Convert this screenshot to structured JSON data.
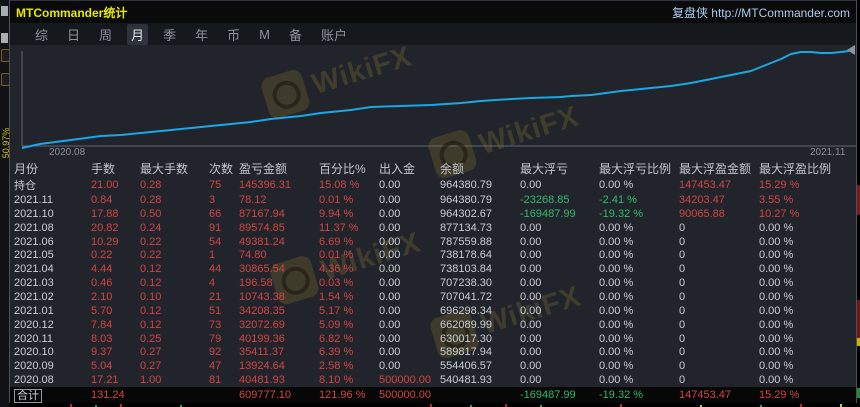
{
  "window": {
    "title": "MTCommander统计",
    "title_right": "复盘侠 http://MTCommander.com"
  },
  "menu": {
    "items": [
      {
        "label": "综",
        "active": false
      },
      {
        "label": "日",
        "active": false
      },
      {
        "label": "周",
        "active": false
      },
      {
        "label": "月",
        "active": true
      },
      {
        "label": "季",
        "active": false
      },
      {
        "label": "年",
        "active": false
      },
      {
        "label": "币",
        "active": false
      },
      {
        "label": "M",
        "active": false
      },
      {
        "label": "备",
        "active": false
      },
      {
        "label": "账户",
        "active": false
      }
    ]
  },
  "background": {
    "vertical_label": "50.97%"
  },
  "watermark": {
    "text": "WikiFX"
  },
  "chart_data": {
    "type": "line",
    "title": "",
    "xlabel_start": "2020.08",
    "xlabel_end": "2021.11",
    "series": [
      {
        "name": "余额",
        "x": [
          "2020.08",
          "2020.09",
          "2020.10",
          "2020.11",
          "2020.12",
          "2021.01",
          "2021.02",
          "2021.03",
          "2021.04",
          "2021.05",
          "2021.06",
          "2021.08",
          "2021.10",
          "2021.11"
        ],
        "values": [
          540481.93,
          554406.57,
          589817.94,
          630017.3,
          662089.99,
          696298.34,
          707041.72,
          707238.3,
          738103.84,
          738178.64,
          787559.88,
          877134.73,
          964302.67,
          964380.79
        ]
      }
    ],
    "line_color": "#18a8e6",
    "grid": false,
    "render_points": [
      [
        12,
        103
      ],
      [
        30,
        99
      ],
      [
        61,
        95
      ],
      [
        91,
        91
      ],
      [
        111,
        90
      ],
      [
        141,
        87
      ],
      [
        161,
        85
      ],
      [
        191,
        82
      ],
      [
        211,
        80
      ],
      [
        241,
        77
      ],
      [
        261,
        74
      ],
      [
        291,
        71
      ],
      [
        311,
        68
      ],
      [
        341,
        65
      ],
      [
        361,
        62
      ],
      [
        391,
        61
      ],
      [
        421,
        60
      ],
      [
        451,
        58
      ],
      [
        471,
        56
      ],
      [
        501,
        54
      ],
      [
        521,
        53
      ],
      [
        551,
        52
      ],
      [
        561,
        51
      ],
      [
        581,
        50
      ],
      [
        611,
        46
      ],
      [
        641,
        43
      ],
      [
        661,
        41
      ],
      [
        681,
        38
      ],
      [
        701,
        34
      ],
      [
        721,
        30
      ],
      [
        741,
        26
      ],
      [
        756,
        20
      ],
      [
        771,
        14
      ],
      [
        781,
        9
      ],
      [
        791,
        7
      ],
      [
        801,
        7
      ],
      [
        811,
        8
      ],
      [
        821,
        8
      ],
      [
        831,
        7
      ],
      [
        839,
        6
      ]
    ]
  },
  "table": {
    "columns": [
      "月份",
      "手数",
      "最大手数",
      "次数",
      "盈亏金额",
      "百分比%",
      "出入金",
      "余额",
      "最大浮亏",
      "最大浮亏比例",
      "最大浮盈金额",
      "最大浮盈比例"
    ],
    "rows": [
      {
        "cells": [
          "持仓",
          "21.00",
          "0.28",
          "75",
          "145396.31",
          "15.08 %",
          "0.00",
          "964380.79",
          "0.00",
          "0.00 %",
          "147453.47",
          "15.29 %"
        ],
        "colors": [
          "w",
          "r",
          "r",
          "r",
          "r",
          "r",
          "w",
          "w",
          "w",
          "w",
          "r",
          "r"
        ],
        "total": false
      },
      {
        "cells": [
          "2021.11",
          "0.84",
          "0.28",
          "3",
          "78.12",
          "0.01 %",
          "0.00",
          "964380.79",
          "-23268.85",
          "-2.41 %",
          "34203.47",
          "3.55 %"
        ],
        "colors": [
          "w",
          "r",
          "r",
          "r",
          "r",
          "r",
          "w",
          "w",
          "g",
          "g",
          "r",
          "r"
        ],
        "total": false
      },
      {
        "cells": [
          "2021.10",
          "17.88",
          "0.50",
          "66",
          "87167.94",
          "9.94 %",
          "0.00",
          "964302.67",
          "-169487.99",
          "-19.32 %",
          "90065.88",
          "10.27 %"
        ],
        "colors": [
          "w",
          "r",
          "r",
          "r",
          "r",
          "r",
          "w",
          "w",
          "g",
          "g",
          "r",
          "r"
        ],
        "total": false
      },
      {
        "cells": [
          "2021.08",
          "20.82",
          "0.24",
          "91",
          "89574.85",
          "11.37 %",
          "0.00",
          "877134.73",
          "0.00",
          "0.00 %",
          "0",
          "0.00 %"
        ],
        "colors": [
          "w",
          "r",
          "r",
          "r",
          "r",
          "r",
          "w",
          "w",
          "w",
          "w",
          "w",
          "w"
        ],
        "total": false
      },
      {
        "cells": [
          "2021.06",
          "10.29",
          "0.22",
          "54",
          "49381.24",
          "6.69 %",
          "0.00",
          "787559.88",
          "0.00",
          "0.00 %",
          "0",
          "0.00 %"
        ],
        "colors": [
          "w",
          "r",
          "r",
          "r",
          "r",
          "r",
          "w",
          "w",
          "w",
          "w",
          "w",
          "w"
        ],
        "total": false
      },
      {
        "cells": [
          "2021.05",
          "0.22",
          "0.22",
          "1",
          "74.80",
          "0.01 %",
          "0.00",
          "738178.64",
          "0.00",
          "0.00 %",
          "0",
          "0.00 %"
        ],
        "colors": [
          "w",
          "r",
          "r",
          "r",
          "r",
          "r",
          "w",
          "w",
          "w",
          "w",
          "w",
          "w"
        ],
        "total": false
      },
      {
        "cells": [
          "2021.04",
          "4.44",
          "0.12",
          "44",
          "30865.54",
          "4.36 %",
          "0.00",
          "738103.84",
          "0.00",
          "0.00 %",
          "0",
          "0.00 %"
        ],
        "colors": [
          "w",
          "r",
          "r",
          "r",
          "r",
          "r",
          "w",
          "w",
          "w",
          "w",
          "w",
          "w"
        ],
        "total": false
      },
      {
        "cells": [
          "2021.03",
          "0.46",
          "0.12",
          "4",
          "196.58",
          "0.03 %",
          "0.00",
          "707238.30",
          "0.00",
          "0.00 %",
          "0",
          "0.00 %"
        ],
        "colors": [
          "w",
          "r",
          "r",
          "r",
          "r",
          "r",
          "w",
          "w",
          "w",
          "w",
          "w",
          "w"
        ],
        "total": false
      },
      {
        "cells": [
          "2021.02",
          "2.10",
          "0.10",
          "21",
          "10743.38",
          "1.54 %",
          "0.00",
          "707041.72",
          "0.00",
          "0.00 %",
          "0",
          "0.00 %"
        ],
        "colors": [
          "w",
          "r",
          "r",
          "r",
          "r",
          "r",
          "w",
          "w",
          "w",
          "w",
          "w",
          "w"
        ],
        "total": false
      },
      {
        "cells": [
          "2021.01",
          "5.70",
          "0.12",
          "51",
          "34208.35",
          "5.17 %",
          "0.00",
          "696298.34",
          "0.00",
          "0.00 %",
          "0",
          "0.00 %"
        ],
        "colors": [
          "w",
          "r",
          "r",
          "r",
          "r",
          "r",
          "w",
          "w",
          "w",
          "w",
          "w",
          "w"
        ],
        "total": false
      },
      {
        "cells": [
          "2020.12",
          "7.84",
          "0.12",
          "73",
          "32072.69",
          "5.09 %",
          "0.00",
          "662089.99",
          "0.00",
          "0.00 %",
          "0",
          "0.00 %"
        ],
        "colors": [
          "w",
          "r",
          "r",
          "r",
          "r",
          "r",
          "w",
          "w",
          "w",
          "w",
          "w",
          "w"
        ],
        "total": false
      },
      {
        "cells": [
          "2020.11",
          "8.03",
          "0.25",
          "79",
          "40199.36",
          "6.82 %",
          "0.00",
          "630017.30",
          "0.00",
          "0.00 %",
          "0",
          "0.00 %"
        ],
        "colors": [
          "w",
          "r",
          "r",
          "r",
          "r",
          "r",
          "w",
          "w",
          "w",
          "w",
          "w",
          "w"
        ],
        "total": false
      },
      {
        "cells": [
          "2020.10",
          "9.37",
          "0.27",
          "92",
          "35411.37",
          "6.39 %",
          "0.00",
          "589817.94",
          "0.00",
          "0.00 %",
          "0",
          "0.00 %"
        ],
        "colors": [
          "w",
          "r",
          "r",
          "r",
          "r",
          "r",
          "w",
          "w",
          "w",
          "w",
          "w",
          "w"
        ],
        "total": false
      },
      {
        "cells": [
          "2020.09",
          "5.04",
          "0.27",
          "47",
          "13924.64",
          "2.58 %",
          "0.00",
          "554406.57",
          "0.00",
          "0.00 %",
          "0",
          "0.00 %"
        ],
        "colors": [
          "w",
          "r",
          "r",
          "r",
          "r",
          "r",
          "w",
          "w",
          "w",
          "w",
          "w",
          "w"
        ],
        "total": false
      },
      {
        "cells": [
          "2020.08",
          "17.21",
          "1.00",
          "81",
          "40481.93",
          "8.10 %",
          "500000.00",
          "540481.93",
          "0.00",
          "0.00 %",
          "0",
          "0.00 %"
        ],
        "colors": [
          "w",
          "r",
          "r",
          "r",
          "r",
          "r",
          "r",
          "w",
          "w",
          "w",
          "w",
          "w"
        ],
        "total": false
      },
      {
        "cells": [
          "合计",
          "131.24",
          "",
          "",
          "609777.10",
          "121.96 %",
          "500000.00",
          "",
          "-169487.99",
          "-19.32 %",
          "147453.47",
          "15.29 %"
        ],
        "colors": [
          "w",
          "r",
          "w",
          "w",
          "r",
          "r",
          "r",
          "w",
          "g",
          "g",
          "r",
          "r"
        ],
        "total": true
      }
    ]
  }
}
